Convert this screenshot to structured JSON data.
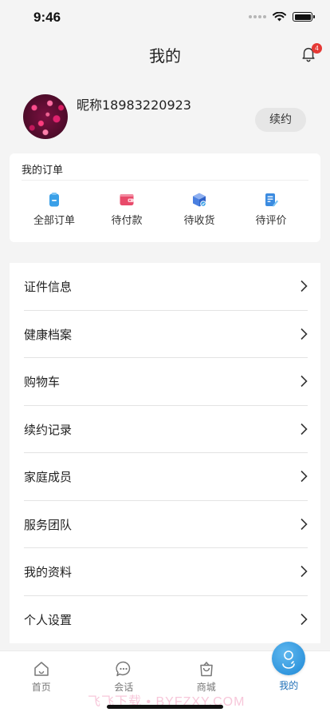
{
  "status_bar": {
    "time": "9:46"
  },
  "nav": {
    "title": "我的",
    "notification_count": "4"
  },
  "profile": {
    "nickname": "昵称18983220923",
    "renew_label": "续约"
  },
  "orders": {
    "title": "我的订单",
    "items": [
      {
        "label": "全部订单",
        "icon": "clipboard-icon",
        "color": "#3aa0e8"
      },
      {
        "label": "待付款",
        "icon": "wallet-icon",
        "color": "#e84a6a"
      },
      {
        "label": "待收货",
        "icon": "package-icon",
        "color": "#4a7fe0"
      },
      {
        "label": "待评价",
        "icon": "edit-note-icon",
        "color": "#3b8be0"
      }
    ]
  },
  "menu": {
    "items": [
      {
        "label": "证件信息"
      },
      {
        "label": "健康档案"
      },
      {
        "label": "购物车"
      },
      {
        "label": "续约记录"
      },
      {
        "label": "家庭成员"
      },
      {
        "label": "服务团队"
      },
      {
        "label": "我的资料"
      },
      {
        "label": "个人设置"
      }
    ]
  },
  "tab_bar": {
    "tabs": [
      {
        "label": "首页",
        "icon": "home-icon"
      },
      {
        "label": "会话",
        "icon": "chat-icon"
      },
      {
        "label": "商城",
        "icon": "shopping-bag-icon"
      },
      {
        "label": "我的",
        "icon": "profile-icon",
        "active": true
      }
    ]
  },
  "watermark": "飞飞下载 • BYFZXY.COM",
  "colors": {
    "accent": "#1f6fb7",
    "badge": "#e53935",
    "background": "#f4f4f4"
  }
}
